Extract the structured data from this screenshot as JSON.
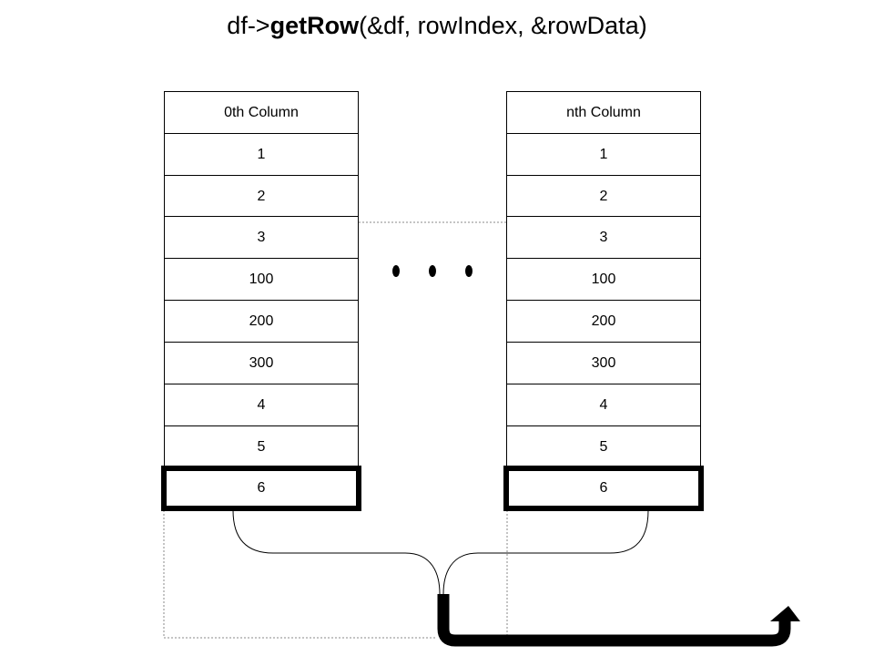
{
  "title": {
    "prefix": "df->",
    "method": "getRow",
    "args": "(&df, rowIndex, &rowData)"
  },
  "columns": [
    {
      "header": "0th Column",
      "cells": [
        "1",
        "2",
        "3",
        "100",
        "200",
        "300",
        "4",
        "5",
        "6"
      ],
      "selected_cell": "6"
    },
    {
      "header": "nth Column",
      "cells": [
        "1",
        "2",
        "3",
        "100",
        "200",
        "300",
        "4",
        "5",
        "6"
      ],
      "selected_cell": "6"
    }
  ],
  "ellipsis": "• • •"
}
